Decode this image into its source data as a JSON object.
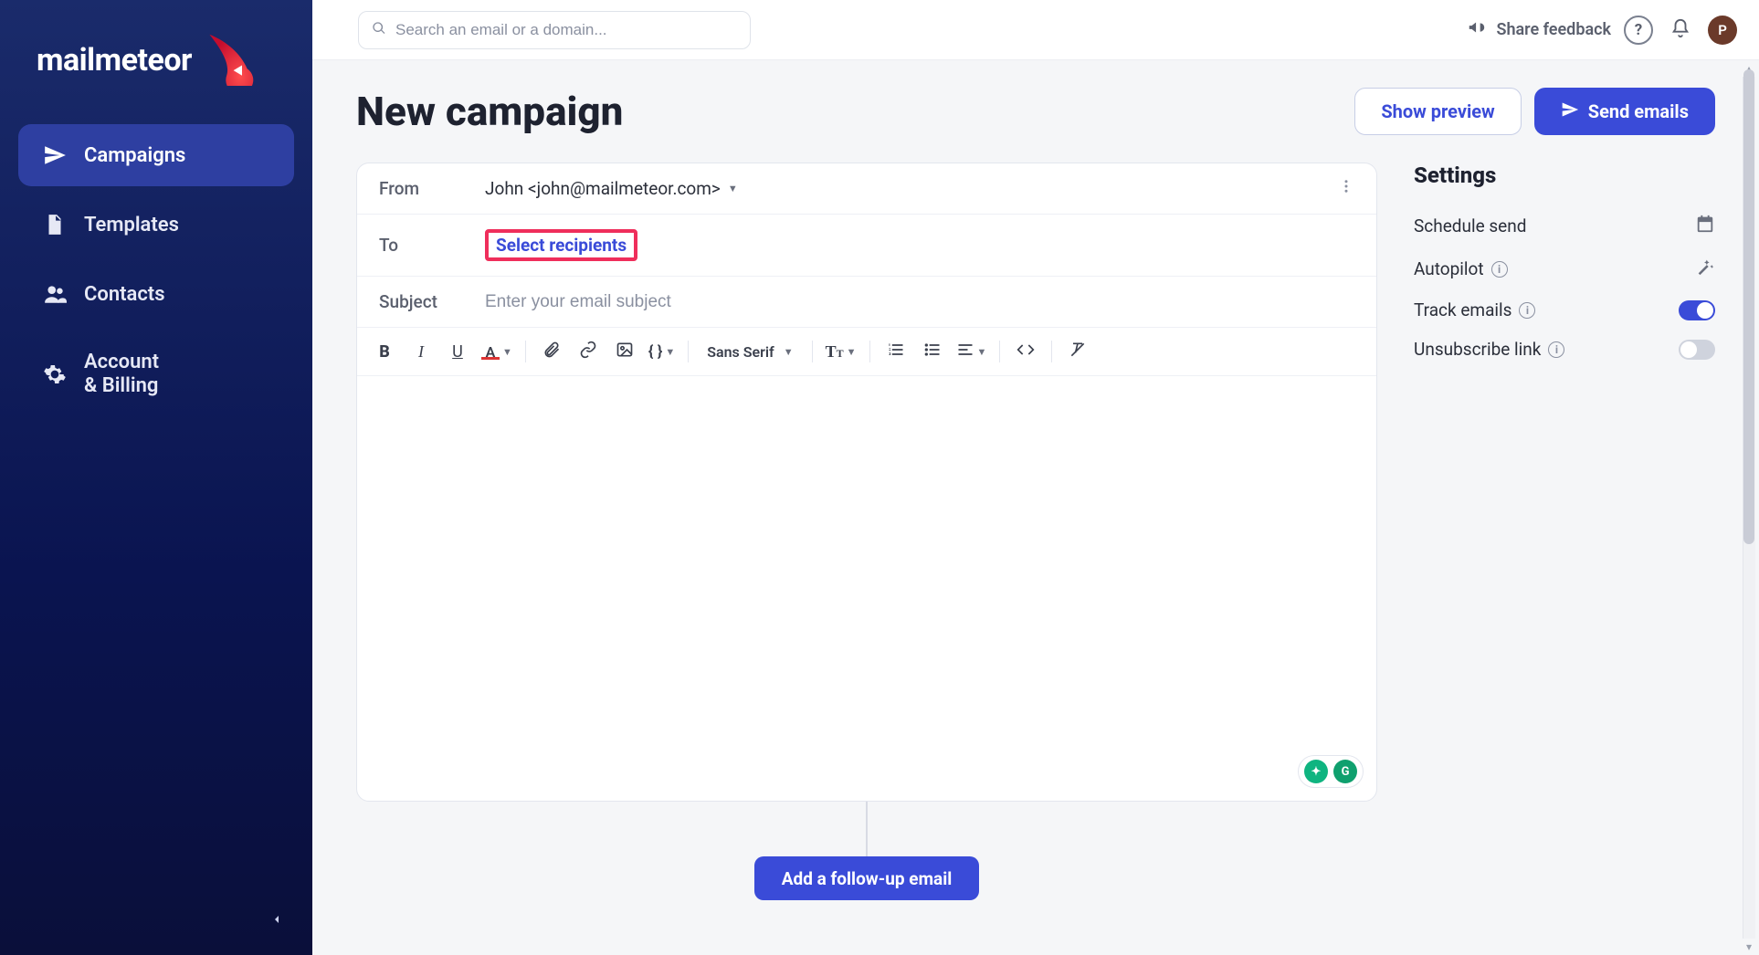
{
  "brand": {
    "name": "mailmeteor"
  },
  "sidebar": {
    "items": [
      {
        "label": "Campaigns",
        "icon": "send"
      },
      {
        "label": "Templates",
        "icon": "file"
      },
      {
        "label": "Contacts",
        "icon": "people"
      },
      {
        "label": "Account\n& Billing",
        "icon": "gear"
      }
    ]
  },
  "topbar": {
    "search_placeholder": "Search an email or a domain...",
    "share_feedback": "Share feedback",
    "avatar_initial": "P"
  },
  "page": {
    "title": "New campaign",
    "show_preview": "Show preview",
    "send_emails": "Send emails"
  },
  "composer": {
    "from_label": "From",
    "from_value": "John <john@mailmeteor.com>",
    "to_label": "To",
    "to_action": "Select recipients",
    "subject_label": "Subject",
    "subject_placeholder": "Enter your email subject",
    "font_family": "Sans Serif",
    "follow_up": "Add a follow-up email"
  },
  "settings": {
    "title": "Settings",
    "schedule": "Schedule send",
    "autopilot": "Autopilot",
    "track": "Track emails",
    "unsubscribe": "Unsubscribe link",
    "track_on": true,
    "unsubscribe_on": false
  },
  "badges": {
    "a": "✦",
    "b": "G"
  }
}
